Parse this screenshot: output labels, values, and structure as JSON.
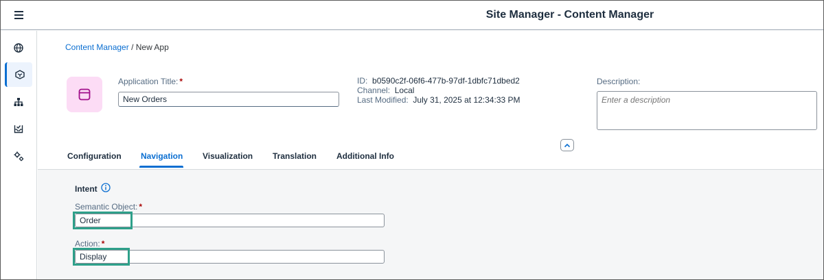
{
  "shell": {
    "title": "Site Manager - Content Manager"
  },
  "sidenav": {
    "items": [
      {
        "icon": "globe-icon"
      },
      {
        "icon": "cube-icon",
        "active": true
      },
      {
        "icon": "hierarchy-icon"
      },
      {
        "icon": "inbox-check-icon"
      },
      {
        "icon": "settings-gears-icon"
      }
    ]
  },
  "breadcrumb": {
    "link": "Content Manager",
    "separator": " / ",
    "current": "New App"
  },
  "app": {
    "icon": "app-window-icon",
    "title_label": "Application Title:",
    "required_mark": "*",
    "title_value": "New Orders",
    "id_label": "ID:",
    "id_value": "b0590c2f-06f6-477b-97df-1dbfc71dbed2",
    "channel_label": "Channel:",
    "channel_value": "Local",
    "modified_label": "Last Modified:",
    "modified_value": "July 31, 2025 at 12:34:33 PM",
    "description_label": "Description:",
    "description_placeholder": "Enter a description"
  },
  "tabs": [
    {
      "label": "Configuration"
    },
    {
      "label": "Navigation",
      "active": true
    },
    {
      "label": "Visualization"
    },
    {
      "label": "Translation"
    },
    {
      "label": "Additional Info"
    }
  ],
  "intent": {
    "title": "Intent",
    "semantic_object_label": "Semantic Object:",
    "semantic_object_value": "Order",
    "action_label": "Action:",
    "action_value": "Display",
    "required_mark": "*"
  },
  "colors": {
    "accent": "#0a6ed1",
    "highlight": "#2ea08a",
    "tile_bg": "#fcdcf5",
    "required": "#aa0808"
  }
}
